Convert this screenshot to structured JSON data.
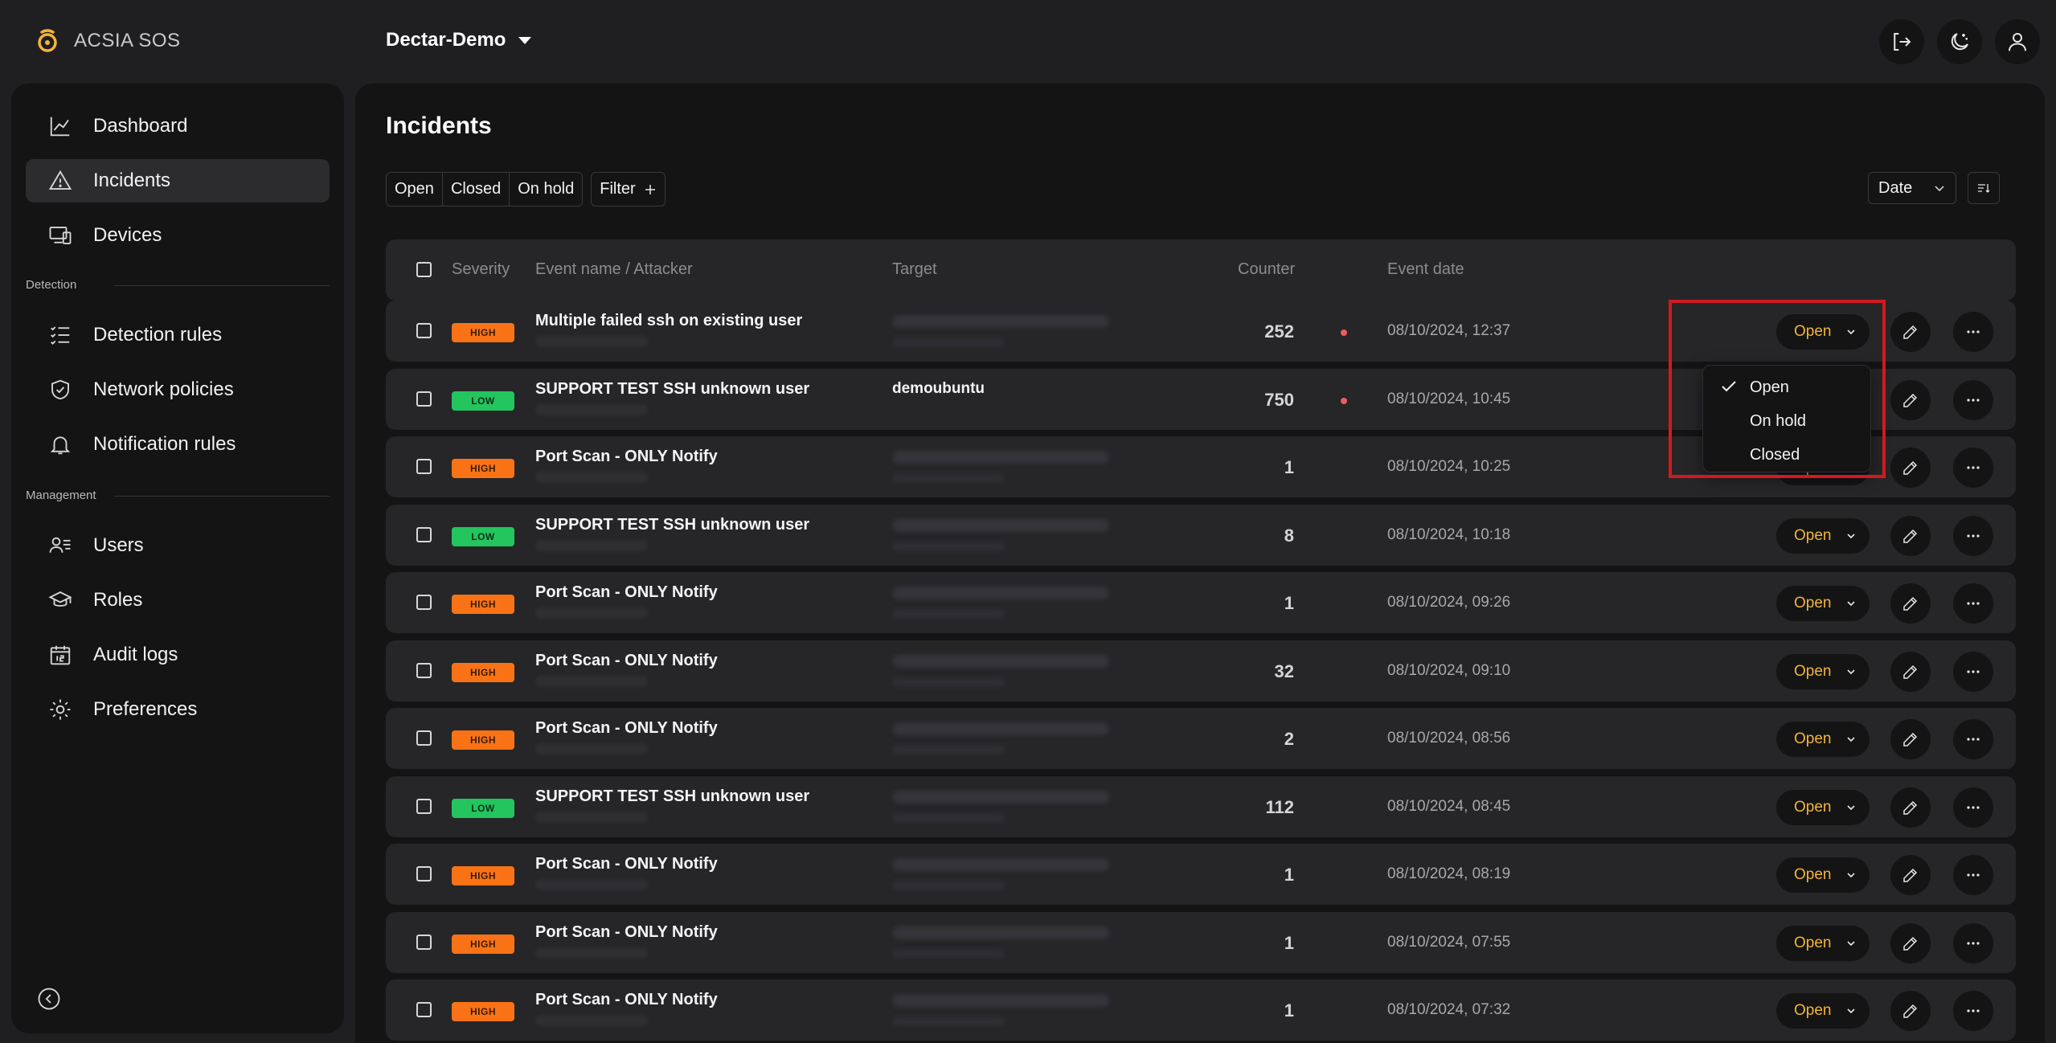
{
  "app": {
    "logo_text": "ACSIA SOS",
    "org_name": "Dectar-Demo",
    "top_actions": [
      "logout-icon",
      "theme-toggle-icon",
      "user-icon"
    ]
  },
  "sidebar": {
    "items": [
      {
        "label": "Dashboard",
        "icon": "chart-line-icon"
      },
      {
        "label": "Incidents",
        "icon": "warning-triangle-icon",
        "active": true
      },
      {
        "label": "Devices",
        "icon": "devices-icon"
      }
    ],
    "detection_section": "Detection",
    "detection_items": [
      {
        "label": "Detection rules",
        "icon": "checklist-icon"
      },
      {
        "label": "Network policies",
        "icon": "shield-icon"
      },
      {
        "label": "Notification rules",
        "icon": "bell-icon"
      }
    ],
    "management_section": "Management",
    "management_items": [
      {
        "label": "Users",
        "icon": "users-icon"
      },
      {
        "label": "Roles",
        "icon": "roles-icon"
      },
      {
        "label": "Audit logs",
        "icon": "calendar-icon"
      },
      {
        "label": "Preferences",
        "icon": "gear-icon"
      }
    ]
  },
  "main": {
    "title": "Incidents",
    "tabs": [
      "Open",
      "Closed",
      "On hold"
    ],
    "filter_label": "Filter",
    "sort_label": "Date",
    "columns": {
      "severity": "Severity",
      "event": "Event name / Attacker",
      "target": "Target",
      "counter": "Counter",
      "date": "Event date"
    },
    "rows": [
      {
        "severity": "HIGH",
        "event": "Multiple failed ssh on existing user",
        "target": "",
        "counter": "252",
        "alert": true,
        "date": "08/10/2024, 12:37",
        "status": "Open"
      },
      {
        "severity": "LOW",
        "event": "SUPPORT TEST SSH unknown user",
        "target": "demoubuntu",
        "counter": "750",
        "alert": true,
        "date": "08/10/2024, 10:45",
        "status": "Open"
      },
      {
        "severity": "HIGH",
        "event": "Port Scan - ONLY Notify",
        "target": "",
        "counter": "1",
        "alert": false,
        "date": "08/10/2024, 10:25",
        "status": "Open"
      },
      {
        "severity": "LOW",
        "event": "SUPPORT TEST SSH unknown user",
        "target": "",
        "counter": "8",
        "alert": false,
        "date": "08/10/2024, 10:18",
        "status": "Open"
      },
      {
        "severity": "HIGH",
        "event": "Port Scan - ONLY Notify",
        "target": "",
        "counter": "1",
        "alert": false,
        "date": "08/10/2024, 09:26",
        "status": "Open"
      },
      {
        "severity": "HIGH",
        "event": "Port Scan - ONLY Notify",
        "target": "",
        "counter": "32",
        "alert": false,
        "date": "08/10/2024, 09:10",
        "status": "Open"
      },
      {
        "severity": "HIGH",
        "event": "Port Scan - ONLY Notify",
        "target": "",
        "counter": "2",
        "alert": false,
        "date": "08/10/2024, 08:56",
        "status": "Open"
      },
      {
        "severity": "LOW",
        "event": "SUPPORT TEST SSH unknown user",
        "target": "",
        "counter": "112",
        "alert": false,
        "date": "08/10/2024, 08:45",
        "status": "Open"
      },
      {
        "severity": "HIGH",
        "event": "Port Scan - ONLY Notify",
        "target": "",
        "counter": "1",
        "alert": false,
        "date": "08/10/2024, 08:19",
        "status": "Open"
      },
      {
        "severity": "HIGH",
        "event": "Port Scan - ONLY Notify",
        "target": "",
        "counter": "1",
        "alert": false,
        "date": "08/10/2024, 07:55",
        "status": "Open"
      },
      {
        "severity": "HIGH",
        "event": "Port Scan - ONLY Notify",
        "target": "",
        "counter": "1",
        "alert": false,
        "date": "08/10/2024, 07:32",
        "status": "Open"
      }
    ],
    "status_dropdown": {
      "options": [
        "Open",
        "On hold",
        "Closed"
      ],
      "selected": "Open"
    }
  },
  "colors": {
    "accent": "#f4b43a",
    "high": "#f97316",
    "low": "#22c55e",
    "alert_dot": "#ef5b5b",
    "highlight": "#d11a1f"
  }
}
